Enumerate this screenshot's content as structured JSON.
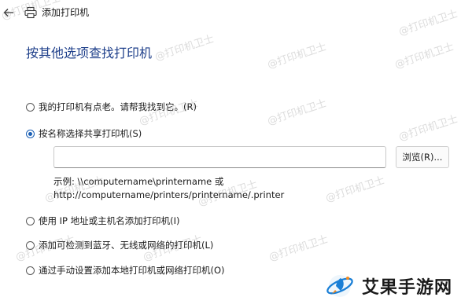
{
  "window": {
    "title": "添加打印机"
  },
  "page": {
    "heading": "按其他选项查找打印机"
  },
  "options": [
    {
      "label": "我的打印机有点老。请帮我找到它。(R)",
      "selected": false
    },
    {
      "label": "按名称选择共享打印机(S)",
      "selected": true
    },
    {
      "label": "使用 IP 地址或主机名添加打印机(I)",
      "selected": false
    },
    {
      "label": "添加可检测到蓝牙、无线或网络的打印机(L)",
      "selected": false
    },
    {
      "label": "通过手动设置添加本地打印机或网络打印机(O)",
      "selected": false
    }
  ],
  "share": {
    "input_value": "",
    "browse_label": "浏览(R)...",
    "example_line1": "示例: \\\\computername\\printername 或",
    "example_line2": "http://computername/printers/printername/.printer"
  },
  "watermark": {
    "text": "@打印机卫士"
  },
  "brand": {
    "text": "艾果手游网"
  },
  "colors": {
    "accent": "#1a5fb4",
    "heading": "#1e3f8a"
  },
  "icons": {
    "back": "back-arrow-icon",
    "printer": "printer-icon",
    "brand": "rocket-logo-icon"
  }
}
